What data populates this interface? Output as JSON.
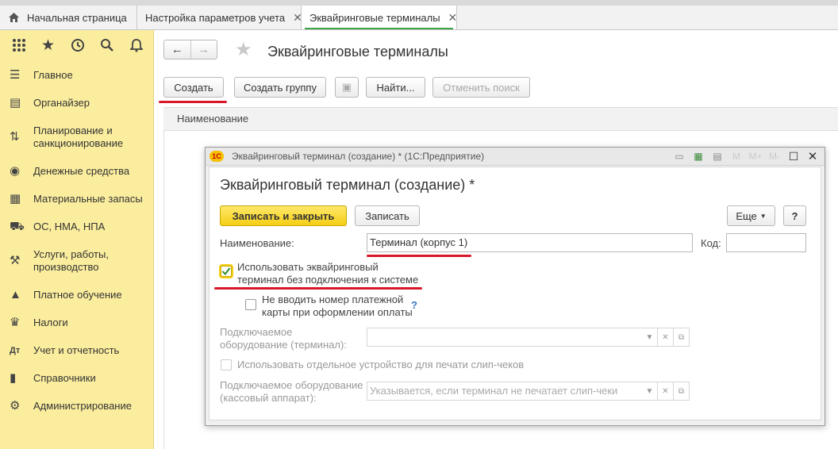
{
  "tabs": [
    {
      "label": "Начальная страница"
    },
    {
      "label": "Настройка параметров учета"
    },
    {
      "label": "Эквайринговые терминалы"
    }
  ],
  "sidebar": {
    "items": [
      {
        "label": "Главное",
        "icon": "menu-icon"
      },
      {
        "label": "Органайзер",
        "icon": "organizer-icon"
      },
      {
        "label": "Планирование и санкционирование",
        "icon": "planning-icon"
      },
      {
        "label": "Денежные средства",
        "icon": "money-icon"
      },
      {
        "label": "Материальные запасы",
        "icon": "inventory-icon"
      },
      {
        "label": "ОС, НМА, НПА",
        "icon": "truck-icon"
      },
      {
        "label": "Услуги, работы, производство",
        "icon": "tools-icon"
      },
      {
        "label": "Платное обучение",
        "icon": "graduation-cap-icon"
      },
      {
        "label": "Налоги",
        "icon": "emblem-icon"
      },
      {
        "label": "Учет и отчетность",
        "icon": "accounting-icon"
      },
      {
        "label": "Справочники",
        "icon": "catalog-icon"
      },
      {
        "label": "Администрирование",
        "icon": "gear-icon"
      }
    ]
  },
  "main": {
    "title": "Эквайринговые терминалы",
    "toolbar": {
      "create": "Создать",
      "create_group": "Создать группу",
      "find": "Найти...",
      "cancel_search": "Отменить поиск"
    },
    "column_header": "Наименование"
  },
  "dialog": {
    "window_title": "Эквайринговый терминал (создание) * (1С:Предприятие)",
    "heading": "Эквайринговый терминал (создание) *",
    "save_close": "Записать и закрыть",
    "save": "Записать",
    "more": "Еще",
    "help": "?",
    "name_label": "Наименование:",
    "name_value": "Терминал (корпус 1)",
    "code_label": "Код:",
    "code_value": "",
    "use_without_connection": "Использовать эквайринговый терминал без подключения к системе",
    "use_without_connection_checked": true,
    "no_card_number": "Не вводить номер платежной карты при оформлении оплаты",
    "no_card_number_checked": false,
    "hint": "?",
    "equipment_label": "Подключаемое оборудование (терминал):",
    "separate_device": "Использовать отдельное устройство для печати слип-чеков",
    "cash_register_label": "Подключаемое оборудование (кассовый аппарат):",
    "cash_register_placeholder": "Указывается, если терминал не печатает слип-чеки"
  },
  "colors": {
    "sidebar": "#fbed9e",
    "accent_yellow": "#f4ce14",
    "underline_red": "#d8182a",
    "active_tab_green": "#3da447"
  }
}
